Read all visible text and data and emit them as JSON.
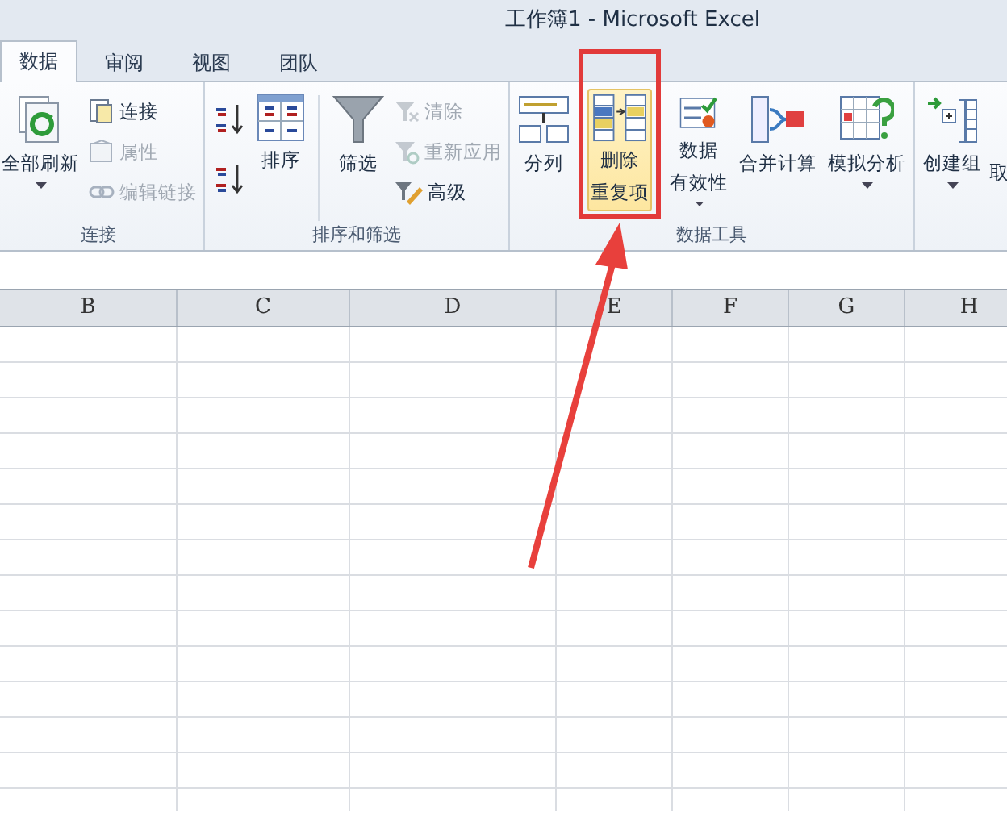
{
  "window": {
    "title": "工作簿1 - Microsoft Excel"
  },
  "tabs": [
    {
      "label": "数据",
      "selected": true
    },
    {
      "label": "审阅",
      "selected": false
    },
    {
      "label": "视图",
      "selected": false
    },
    {
      "label": "团队",
      "selected": false
    }
  ],
  "ribbon": {
    "groups": [
      {
        "label": "连接",
        "items": [
          {
            "kind": "large",
            "label": "全部刷新",
            "dropdown": true,
            "highlighted": false
          },
          {
            "kind": "stack",
            "items": [
              {
                "kind": "small",
                "label": "连接",
                "disabled": false
              },
              {
                "kind": "small",
                "label": "属性",
                "disabled": true
              },
              {
                "kind": "small",
                "label": "编辑链接",
                "disabled": true
              }
            ]
          }
        ]
      },
      {
        "label": "排序和筛选",
        "items": [
          {
            "kind": "stack",
            "items": [
              {
                "kind": "icon",
                "disabled": false
              },
              {
                "kind": "icon",
                "disabled": false
              }
            ]
          },
          {
            "kind": "large",
            "label": "排序",
            "dropdown": false,
            "highlighted": false
          },
          {
            "kind": "separator"
          },
          {
            "kind": "large",
            "label": "筛选",
            "dropdown": false,
            "highlighted": false
          },
          {
            "kind": "stack",
            "items": [
              {
                "kind": "small",
                "label": "清除",
                "disabled": true
              },
              {
                "kind": "small",
                "label": "重新应用",
                "disabled": true
              },
              {
                "kind": "small",
                "label": "高级",
                "disabled": false
              }
            ]
          }
        ]
      },
      {
        "label": "数据工具",
        "items": [
          {
            "kind": "large",
            "label": "分列",
            "dropdown": false,
            "highlighted": false
          },
          {
            "kind": "large",
            "label": [
              "删除",
              "重复项"
            ],
            "dropdown": false,
            "highlighted": true
          },
          {
            "kind": "large",
            "label": [
              "数据",
              "有效性"
            ],
            "dropdown": true,
            "highlighted": false
          },
          {
            "kind": "large",
            "label": "合并计算",
            "dropdown": false,
            "highlighted": false
          },
          {
            "kind": "large",
            "label": "模拟分析",
            "dropdown": true,
            "highlighted": false
          }
        ]
      },
      {
        "items": [
          {
            "kind": "large",
            "label": "创建组",
            "dropdown": true,
            "highlighted": false
          },
          {
            "kind": "text",
            "label": "取"
          }
        ]
      }
    ]
  },
  "columns": [
    "B",
    "C",
    "D",
    "E",
    "F",
    "G",
    "H"
  ]
}
